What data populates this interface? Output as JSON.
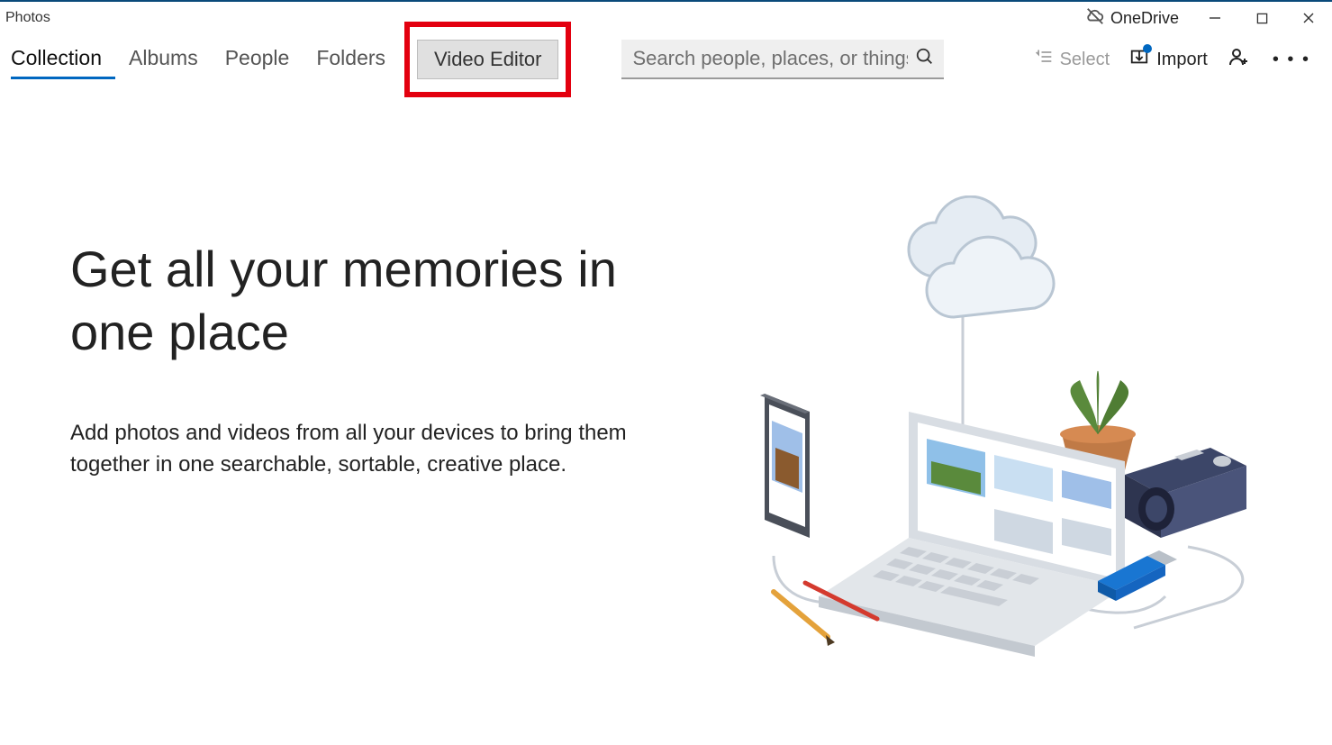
{
  "app": {
    "title": "Photos"
  },
  "titlebar": {
    "onedrive": "OneDrive"
  },
  "nav": {
    "tabs": [
      {
        "label": "Collection",
        "active": true
      },
      {
        "label": "Albums",
        "active": false
      },
      {
        "label": "People",
        "active": false
      },
      {
        "label": "Folders",
        "active": false
      }
    ],
    "video_editor": "Video Editor",
    "search_placeholder": "Search people, places, or things",
    "select": "Select",
    "import": "Import"
  },
  "hero": {
    "heading": "Get all your memories in one place",
    "body": "Add photos and videos from all your devices to bring them together in one searchable, sortable, creative place."
  }
}
